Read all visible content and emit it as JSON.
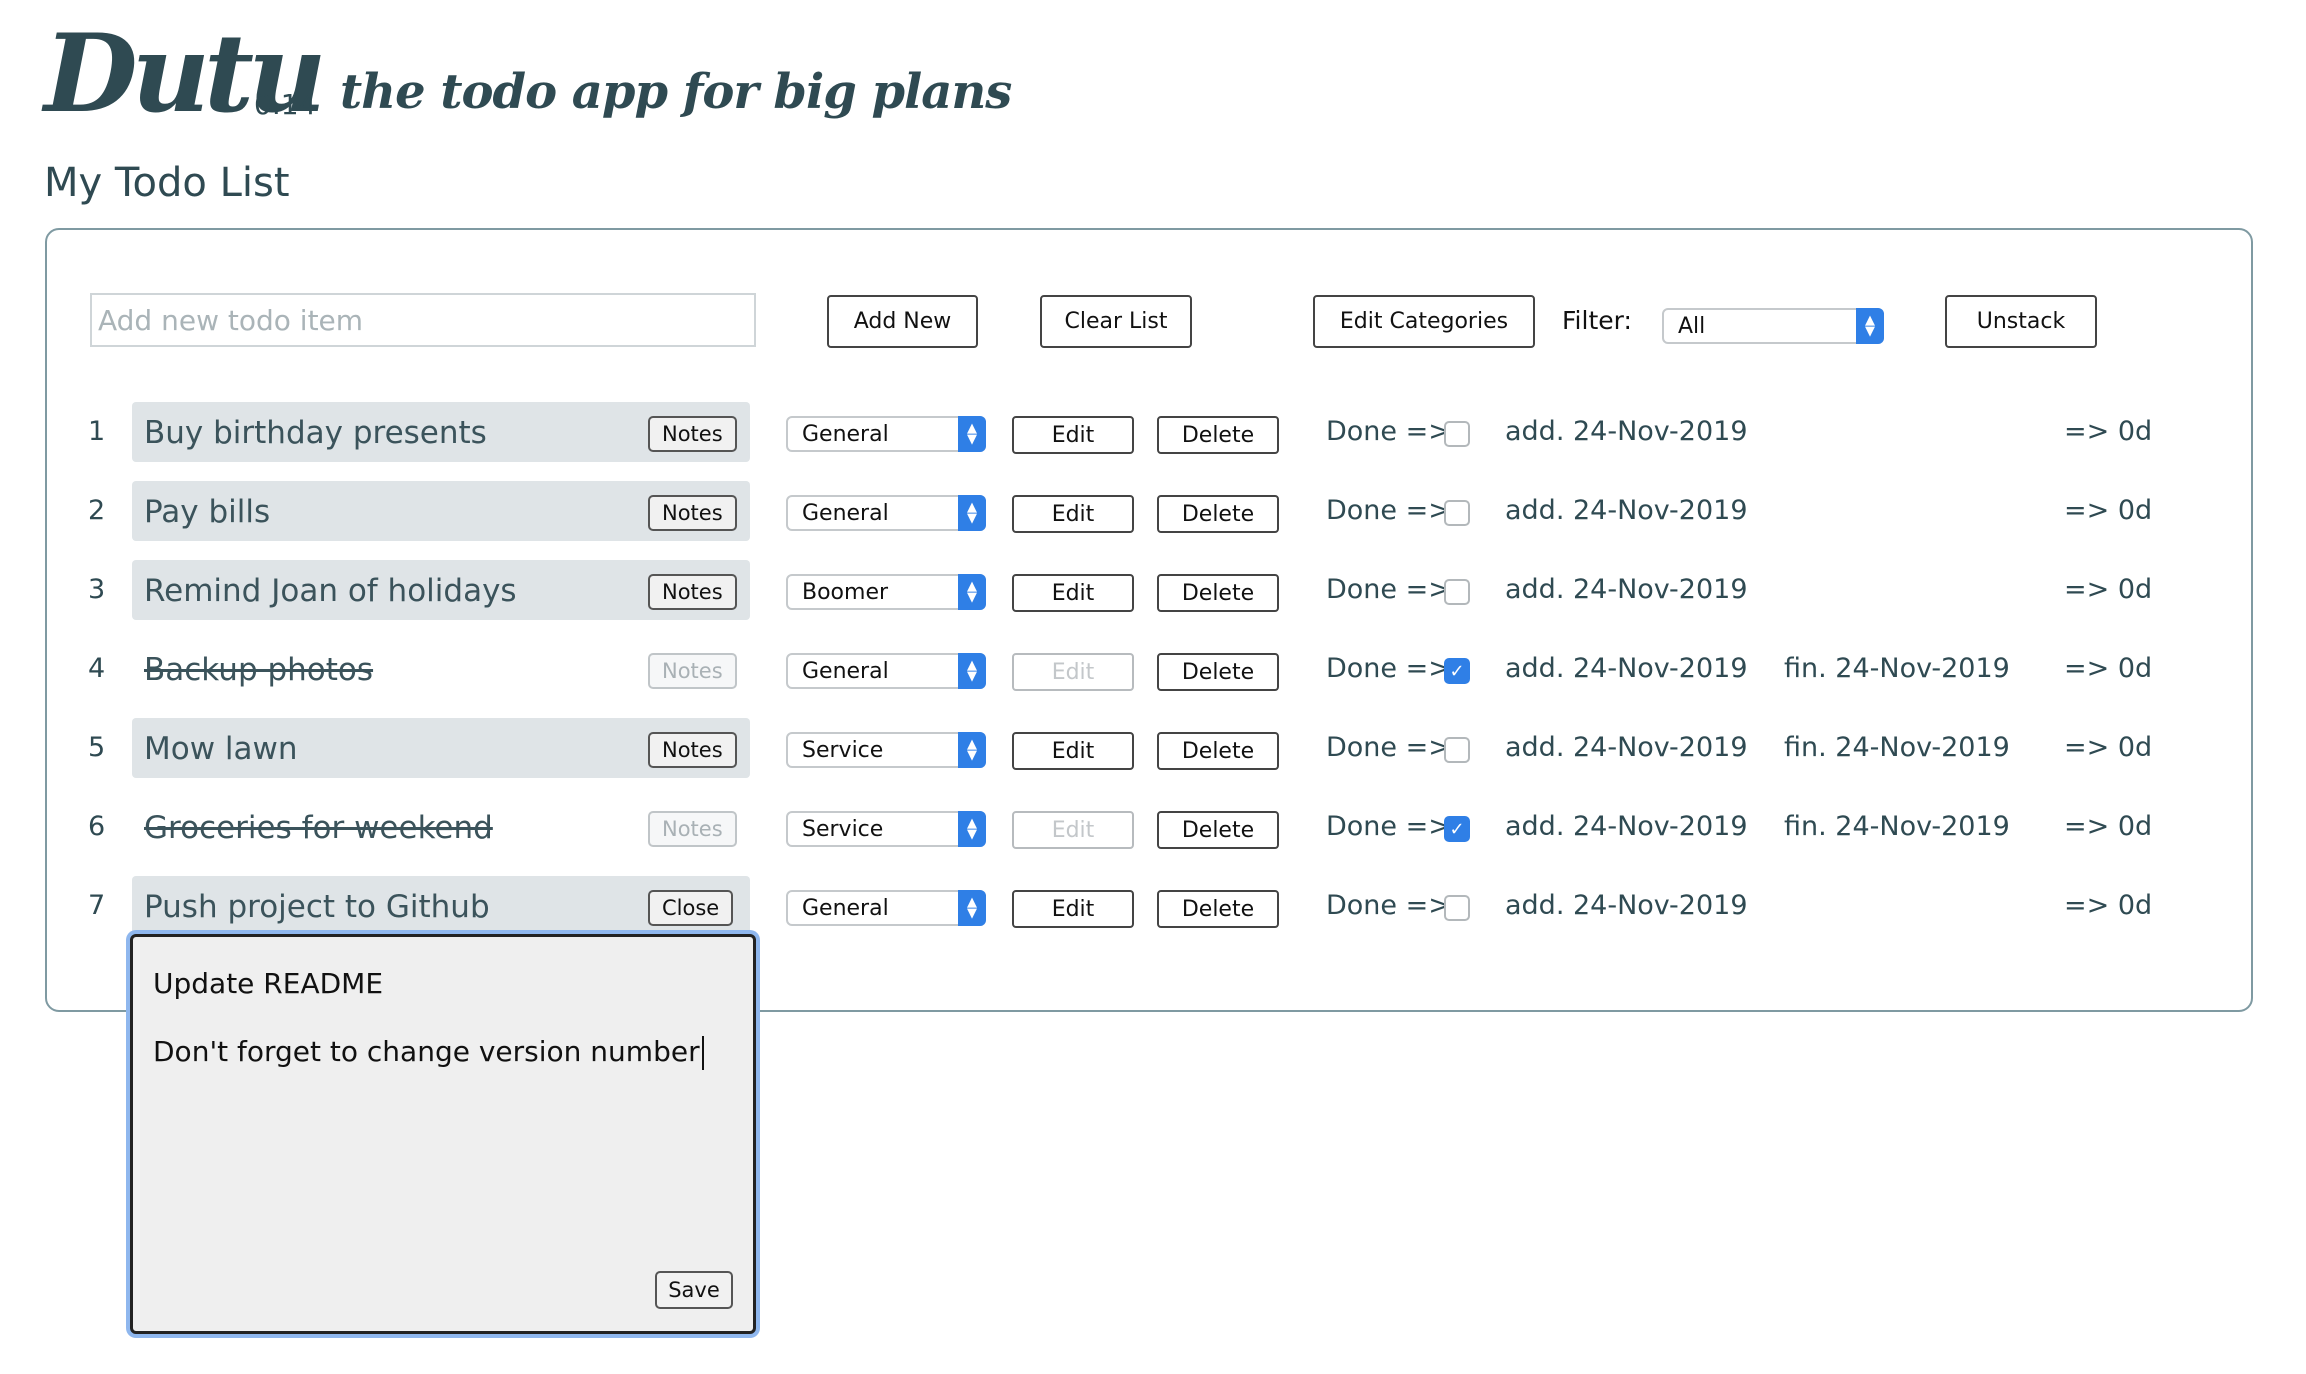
{
  "app": {
    "name": "Dutu",
    "version": "0.14",
    "tagline": "the todo app for big plans",
    "page_title": "My Todo List"
  },
  "toolbar": {
    "new_item_placeholder": "Add new todo item",
    "add_new_label": "Add New",
    "clear_list_label": "Clear List",
    "edit_categories_label": "Edit Categories",
    "filter_label": "Filter:",
    "filter_value": "All",
    "unstack_label": "Unstack"
  },
  "items": [
    {
      "num": "1",
      "text": "Buy birthday presents",
      "notes_label": "Notes",
      "category": "General",
      "edit_label": "Edit",
      "delete_label": "Delete",
      "done_label": "Done =>",
      "done": false,
      "added": "add. 24-Nov-2019",
      "finished": "",
      "duration": "=> 0d"
    },
    {
      "num": "2",
      "text": "Pay bills",
      "notes_label": "Notes",
      "category": "General",
      "edit_label": "Edit",
      "delete_label": "Delete",
      "done_label": "Done =>",
      "done": false,
      "added": "add. 24-Nov-2019",
      "finished": "",
      "duration": "=> 0d"
    },
    {
      "num": "3",
      "text": "Remind Joan of holidays",
      "notes_label": "Notes",
      "category": "Boomer",
      "edit_label": "Edit",
      "delete_label": "Delete",
      "done_label": "Done =>",
      "done": false,
      "added": "add. 24-Nov-2019",
      "finished": "",
      "duration": "=> 0d"
    },
    {
      "num": "4",
      "text": "Backup photos",
      "notes_label": "Notes",
      "category": "General",
      "edit_label": "Edit",
      "delete_label": "Delete",
      "done_label": "Done =>",
      "done": true,
      "added": "add. 24-Nov-2019",
      "finished": "fin. 24-Nov-2019",
      "duration": "=> 0d"
    },
    {
      "num": "5",
      "text": "Mow lawn",
      "notes_label": "Notes",
      "category": "Service",
      "edit_label": "Edit",
      "delete_label": "Delete",
      "done_label": "Done =>",
      "done": false,
      "added": "add. 24-Nov-2019",
      "finished": "fin. 24-Nov-2019",
      "duration": "=> 0d"
    },
    {
      "num": "6",
      "text": "Groceries for weekend",
      "notes_label": "Notes",
      "category": "Service",
      "edit_label": "Edit",
      "delete_label": "Delete",
      "done_label": "Done =>",
      "done": true,
      "added": "add. 24-Nov-2019",
      "finished": "fin. 24-Nov-2019",
      "duration": "=> 0d"
    },
    {
      "num": "7",
      "text": "Push project to Github",
      "notes_label": "Close",
      "category": "General",
      "edit_label": "Edit",
      "delete_label": "Delete",
      "done_label": "Done =>",
      "done": false,
      "added": "add. 24-Nov-2019",
      "finished": "",
      "duration": "=> 0d"
    }
  ],
  "notes_editor": {
    "line1": "Update README",
    "line2": "Don't forget to change version number",
    "save_label": "Save"
  },
  "colors": {
    "text": "#2f4a52",
    "row_bg": "#dfe4e7",
    "accent": "#2f7fe6"
  }
}
